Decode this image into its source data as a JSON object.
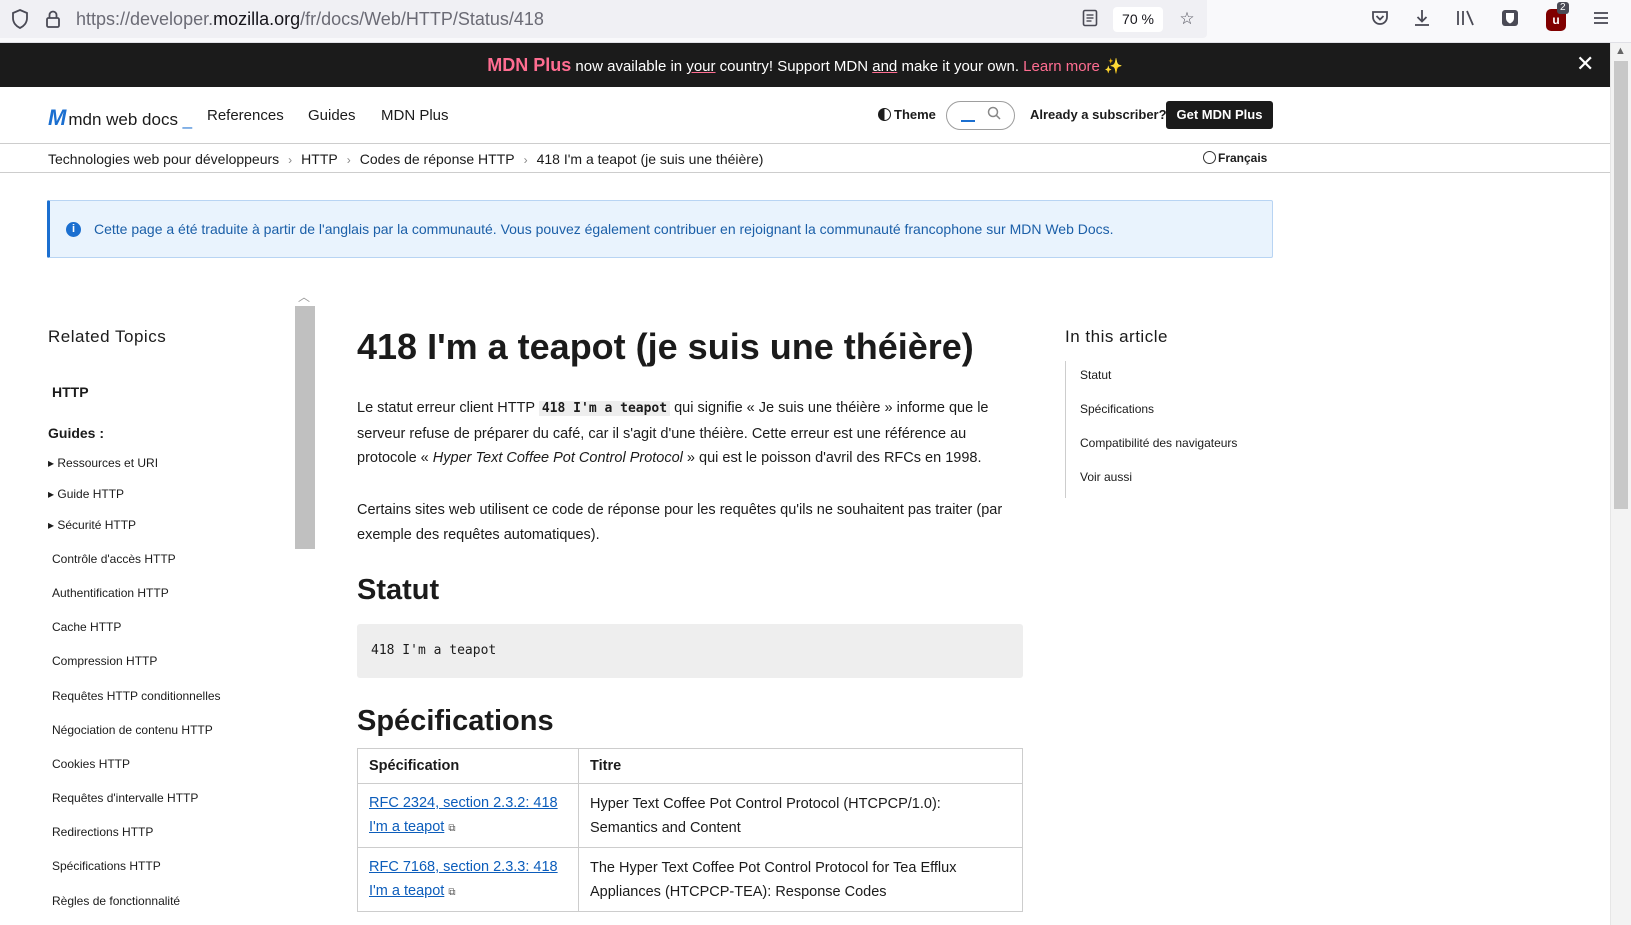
{
  "browser": {
    "url_prefix": "https://developer.",
    "url_domain": "mozilla.org",
    "url_path": "/fr/docs/Web/HTTP/Status/418",
    "zoom": "70 %",
    "ublock_badge": "2",
    "icons": [
      "shield-icon",
      "lock-icon",
      "reader-view-icon",
      "bookmark-star-icon",
      "pocket-icon",
      "download-icon",
      "library-icon",
      "bitwarden-icon",
      "ublock-icon",
      "menu-icon"
    ]
  },
  "banner": {
    "brand": "MDN Plus",
    "text_1": " now available in ",
    "u1": "your",
    "text_2": " country! Support MDN ",
    "u2": "and",
    "text_3": " make it your own. ",
    "learn": "Learn more",
    "spark": " ✨"
  },
  "header": {
    "logo_text": "mdn web docs",
    "nav": [
      "References",
      "Guides",
      "MDN Plus"
    ],
    "theme": "Theme",
    "subscriber": "Already a subscriber?",
    "cta": "Get MDN Plus"
  },
  "breadcrumb": [
    "Technologies web pour développeurs",
    "HTTP",
    "Codes de réponse HTTP",
    "418 I'm a teapot (je suis une théière)"
  ],
  "language": "Français",
  "notice": "Cette page a été traduite à partir de l'anglais par la communauté. Vous pouvez également contribuer en rejoignant la communauté francophone sur MDN Web Docs.",
  "sidebar": {
    "title": "Related Topics",
    "root": "HTTP",
    "guides_label": "Guides :",
    "items": [
      {
        "label": "Ressources et URI",
        "tri": true
      },
      {
        "label": "Guide HTTP",
        "tri": true
      },
      {
        "label": "Sécurité HTTP",
        "tri": true
      },
      {
        "label": "Contrôle d'accès HTTP",
        "tri": false
      },
      {
        "label": "Authentification HTTP",
        "tri": false
      },
      {
        "label": "Cache HTTP",
        "tri": false
      },
      {
        "label": "Compression HTTP",
        "tri": false
      },
      {
        "label": "Requêtes HTTP conditionnelles",
        "tri": false
      },
      {
        "label": "Négociation de contenu HTTP",
        "tri": false
      },
      {
        "label": "Cookies HTTP",
        "tri": false
      },
      {
        "label": "Requêtes d'intervalle HTTP",
        "tri": false
      },
      {
        "label": "Redirections HTTP",
        "tri": false
      },
      {
        "label": "Spécifications HTTP",
        "tri": false
      },
      {
        "label": "Règles de fonctionnalité",
        "tri": false
      }
    ]
  },
  "article": {
    "title": "418 I'm a teapot (je suis une théière)",
    "p1_a": "Le statut erreur client HTTP ",
    "p1_code": "418 I'm a teapot",
    "p1_b": " qui signifie « Je suis une théière » informe que le serveur refuse de préparer du café, car il s'agit d'une théière. Cette erreur est une référence au protocole « ",
    "p1_em": "Hyper Text Coffee Pot Control Protocol",
    "p1_c": " » qui est le poisson d'avril des RFCs en 1998.",
    "p2": "Certains sites web utilisent ce code de réponse pour les requêtes qu'ils ne souhaitent pas traiter (par exemple des requêtes automatiques).",
    "h_status": "Statut",
    "status_code": "418 I'm a teapot",
    "h_specs": "Spécifications",
    "spec_headers": [
      "Spécification",
      "Titre"
    ],
    "specs": [
      {
        "link": "RFC 2324, section 2.3.2: 418 I'm a teapot",
        "title": "Hyper Text Coffee Pot Control Protocol (HTCPCP/1.0): Semantics and Content"
      },
      {
        "link": "RFC 7168, section 2.3.3: 418 I'm a teapot",
        "title": "The Hyper Text Coffee Pot Control Protocol for Tea Efflux Appliances (HTCPCP-TEA): Response Codes"
      }
    ]
  },
  "toc": {
    "title": "In this article",
    "items": [
      "Statut",
      "Spécifications",
      "Compatibilité des navigateurs",
      "Voir aussi"
    ]
  }
}
